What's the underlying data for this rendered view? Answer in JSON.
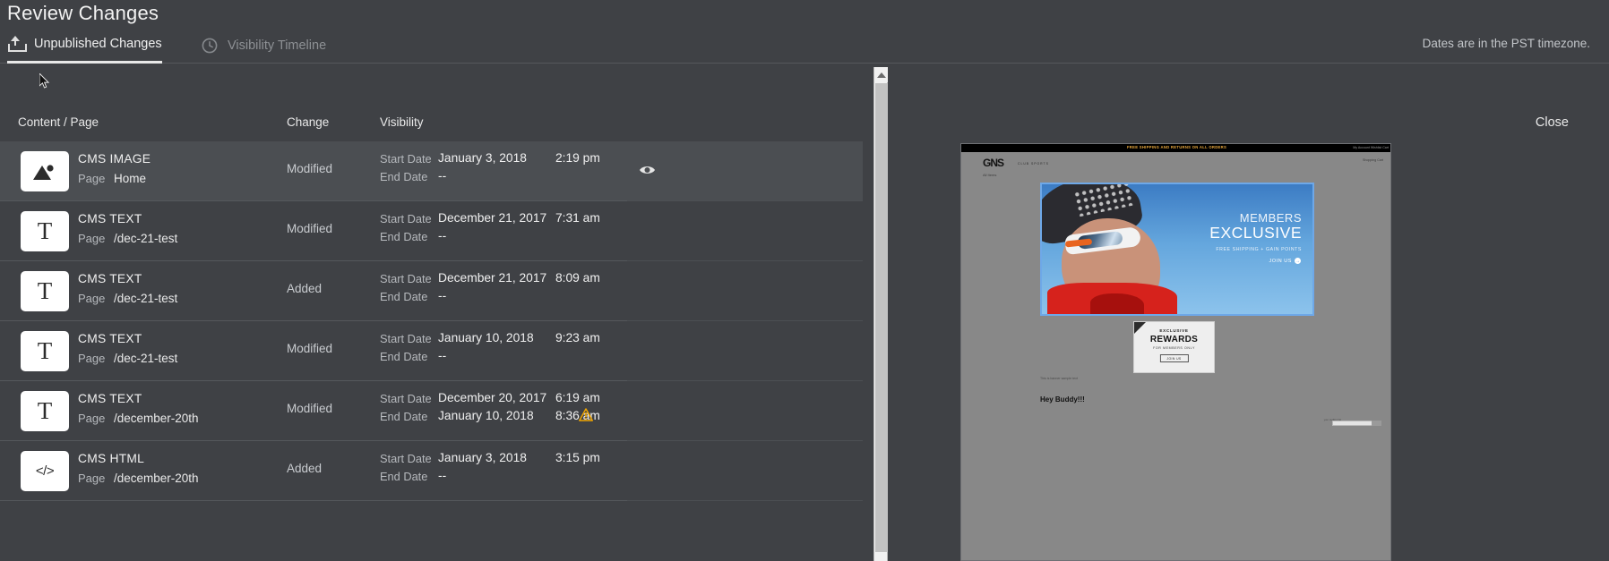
{
  "header": {
    "title": "Review Changes",
    "tabs": [
      {
        "label": "Unpublished Changes",
        "icon": "upload-icon",
        "active": true
      },
      {
        "label": "Visibility Timeline",
        "icon": "clock-icon",
        "active": false
      }
    ],
    "timezone_note": "Dates are in the PST timezone."
  },
  "table": {
    "columns": {
      "content": "Content / Page",
      "change": "Change",
      "visibility": "Visibility"
    },
    "labels": {
      "page": "Page",
      "start_date": "Start Date",
      "end_date": "End Date",
      "empty": "--"
    },
    "rows": [
      {
        "icon": "image-icon",
        "type": "CMS IMAGE",
        "page": "Home",
        "change": "Modified",
        "start_date": "January 3, 2018",
        "start_time": "2:19 pm",
        "end_date": "--",
        "end_time": "",
        "selected": true,
        "has_eye": true,
        "has_warning": false
      },
      {
        "icon": "text-icon",
        "type": "CMS TEXT",
        "page": "/dec-21-test",
        "change": "Modified",
        "start_date": "December 21, 2017",
        "start_time": "7:31 am",
        "end_date": "--",
        "end_time": "",
        "selected": false,
        "has_eye": false,
        "has_warning": false
      },
      {
        "icon": "text-icon",
        "type": "CMS TEXT",
        "page": "/dec-21-test",
        "change": "Added",
        "start_date": "December 21, 2017",
        "start_time": "8:09 am",
        "end_date": "--",
        "end_time": "",
        "selected": false,
        "has_eye": false,
        "has_warning": false
      },
      {
        "icon": "text-icon",
        "type": "CMS TEXT",
        "page": "/dec-21-test",
        "change": "Modified",
        "start_date": "January 10, 2018",
        "start_time": "9:23 am",
        "end_date": "--",
        "end_time": "",
        "selected": false,
        "has_eye": false,
        "has_warning": false
      },
      {
        "icon": "text-icon",
        "type": "CMS TEXT",
        "page": "/december-20th",
        "change": "Modified",
        "start_date": "December 20, 2017",
        "start_time": "6:19 am",
        "end_date": "January 10, 2018",
        "end_time": "8:36 am",
        "selected": false,
        "has_eye": false,
        "has_warning": true
      },
      {
        "icon": "html-icon",
        "type": "CMS HTML",
        "page": "/december-20th",
        "change": "Added",
        "start_date": "January 3, 2018",
        "start_time": "3:15 pm",
        "end_date": "--",
        "end_time": "",
        "selected": false,
        "has_eye": false,
        "has_warning": false
      }
    ]
  },
  "preview": {
    "close_label": "Close",
    "site": {
      "promo_bar": "FREE SHIPPING AND RETURNS ON ALL ORDERS",
      "account_links": "My Account  Wishlist  Cart",
      "logo": "GNS",
      "logo_sub": "CLUB  SPORTS",
      "cart": "Shopping Cart",
      "nav": "All Items",
      "hero": {
        "line1": "MEMBERS",
        "line2": "EXCLUSIVE",
        "line3": "FREE SHIPPING + GAIN POINTS",
        "cta": "JOIN US",
        "cta_arrow": "→"
      },
      "rewards": {
        "line1": "EXCLUSIVE",
        "line2": "REWARDS",
        "line3": "FOR MEMBERS ONLY",
        "button": "JOIN US"
      },
      "note": "This is banner sample text",
      "heading": "Hey Buddy!!!",
      "footer_label": "your mailing list",
      "footer_button": "GO"
    }
  },
  "icons": {
    "upload": "upload-icon",
    "clock": "clock-icon",
    "eye": "eye-icon",
    "warning": "warning-triangle-icon",
    "cursor": "mouse-cursor"
  },
  "colors": {
    "background": "#3f4145",
    "row_selected": "#4b4e52",
    "text_primary": "#f0f0f0",
    "text_muted": "#b6b9bd",
    "warning": "#f0a500",
    "scrollbar_track": "#f1f1f1",
    "scrollbar_thumb": "#c2c2c2"
  }
}
